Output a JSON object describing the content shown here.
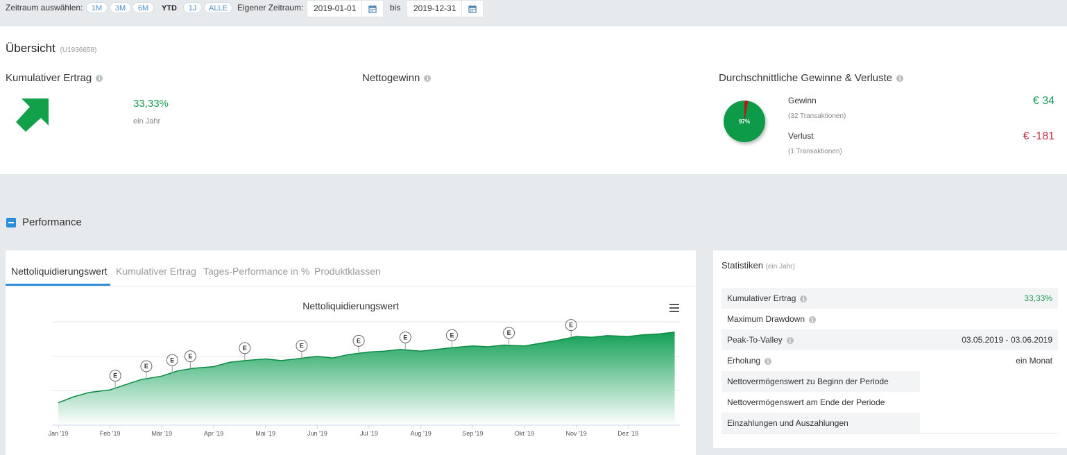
{
  "period": {
    "select_label": "Zeitraum auswählen:",
    "buttons": [
      "1M",
      "3M",
      "6M",
      "YTD",
      "1J",
      "ALLE"
    ],
    "active": "YTD",
    "custom_label": "Eigener Zeitraum:",
    "from": "2019-01-01",
    "to_label": "bis",
    "to": "2019-12-31"
  },
  "overview": {
    "title": "Übersicht",
    "account": "(U1936658)",
    "cumulative": {
      "title": "Kumulativer Ertrag",
      "value": "33,33%",
      "period": "ein Jahr"
    },
    "net_profit": {
      "title": "Nettogewinn"
    },
    "avg": {
      "title": "Durchschnittliche Gewinne & Verluste",
      "pie_label": "97%",
      "gain_label": "Gewinn",
      "gain_tx": "(32 Transaktionen)",
      "gain_value": "€ 34",
      "loss_label": "Verlust",
      "loss_tx": "(1 Transaktionen)",
      "loss_value": "€ -181",
      "gain_share": 0.97,
      "colors": {
        "gain": "#0a9a4a",
        "loss": "#b31b1b"
      }
    }
  },
  "performance": {
    "title": "Performance",
    "tabs": [
      "Nettoliquidierungswert",
      "Kumulativer Ertrag",
      "Tages-Performance in %",
      "Produktklassen"
    ],
    "active_tab": 0
  },
  "chart_data": {
    "type": "area",
    "title": "Nettoliquidierungswert",
    "x_ticks": [
      "Jan '19",
      "Feb '19",
      "Mär '19",
      "Apr '19",
      "Mai '19",
      "Jun '19",
      "Jul '19",
      "Aug '19",
      "Sep '19",
      "Okt '19",
      "Nov '19",
      "Dez '19"
    ],
    "x": [
      0,
      0.3,
      0.6,
      1.0,
      1.3,
      1.6,
      2.0,
      2.3,
      2.6,
      3.0,
      3.3,
      3.6,
      4.0,
      4.3,
      4.6,
      5.0,
      5.3,
      5.6,
      6.0,
      6.3,
      6.6,
      7.0,
      7.3,
      7.6,
      8.0,
      8.3,
      8.6,
      9.0,
      9.3,
      9.6,
      10.0,
      10.3,
      10.6,
      11.0,
      11.3,
      11.6,
      11.9
    ],
    "y": [
      0.26,
      0.33,
      0.38,
      0.41,
      0.47,
      0.53,
      0.57,
      0.63,
      0.66,
      0.68,
      0.73,
      0.75,
      0.77,
      0.75,
      0.77,
      0.8,
      0.78,
      0.82,
      0.85,
      0.86,
      0.88,
      0.86,
      0.88,
      0.9,
      0.92,
      0.91,
      0.93,
      0.92,
      0.95,
      0.98,
      1.03,
      1.02,
      1.04,
      1.03,
      1.05,
      1.06,
      1.08
    ],
    "events": [
      {
        "x": 1.1,
        "label": "E"
      },
      {
        "x": 1.7,
        "label": "E"
      },
      {
        "x": 2.2,
        "label": "E"
      },
      {
        "x": 2.55,
        "label": "E"
      },
      {
        "x": 3.6,
        "label": "E"
      },
      {
        "x": 4.7,
        "label": "E"
      },
      {
        "x": 5.8,
        "label": "E"
      },
      {
        "x": 6.7,
        "label": "E"
      },
      {
        "x": 7.6,
        "label": "E"
      },
      {
        "x": 8.7,
        "label": "E"
      },
      {
        "x": 9.9,
        "label": "E"
      }
    ],
    "colors": {
      "fill_top": "#12a055",
      "fill_bottom": "#ffffff",
      "line": "#0b8a45"
    }
  },
  "stats": {
    "title": "Statistiken",
    "subtitle": "(ein Jahr)",
    "rows": [
      {
        "label": "Kumulativer Ertrag",
        "value": "33,33%",
        "info": true
      },
      {
        "label": "Maximum Drawdown",
        "value": "",
        "info": true
      },
      {
        "label": "Peak-To-Valley",
        "value": "03.05.2019 - 03.06.2019",
        "info": true
      },
      {
        "label": "Erholung",
        "value": "ein Monat",
        "info": true
      },
      {
        "label": "Nettovermögenswert zu Beginn der Periode",
        "value": ""
      },
      {
        "label": "Nettovermögenswert am Ende der Periode",
        "value": ""
      },
      {
        "label": "Einzahlungen und Auszahlungen",
        "value": ""
      }
    ]
  }
}
